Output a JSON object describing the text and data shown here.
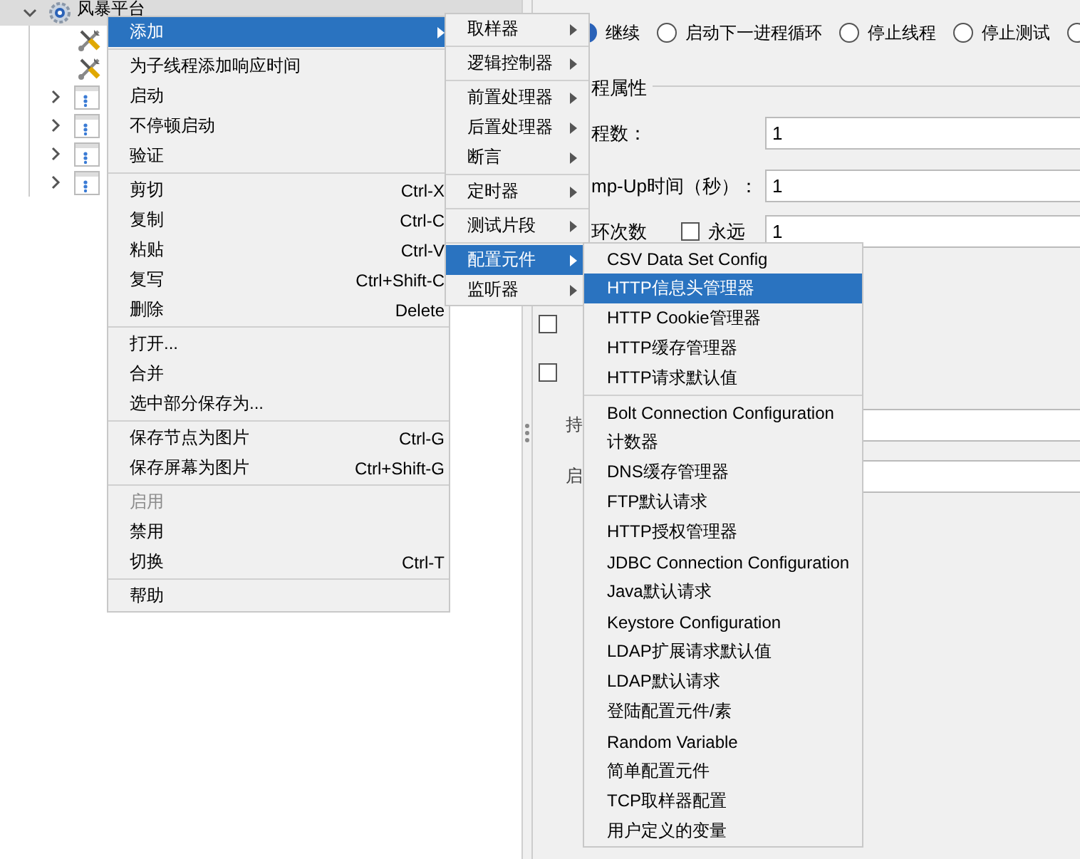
{
  "tree": {
    "root": {
      "label": "风暴平台",
      "expanded": true,
      "selected": true
    },
    "items": [
      {
        "kind": "tool"
      },
      {
        "kind": "tool"
      },
      {
        "kind": "group",
        "expanded": false
      },
      {
        "kind": "group",
        "expanded": false
      },
      {
        "kind": "group",
        "expanded": false
      },
      {
        "kind": "group",
        "expanded": false
      }
    ]
  },
  "panel": {
    "radios": [
      {
        "label": "继续",
        "selected": true
      },
      {
        "label": "启动下一进程循环",
        "selected": false
      },
      {
        "label": "停止线程",
        "selected": false
      },
      {
        "label": "停止测试",
        "selected": false
      },
      {
        "selected": false
      }
    ],
    "group_title": "程属性",
    "fields": [
      {
        "kind": "plain",
        "label": "程数：",
        "value": "1"
      },
      {
        "kind": "plain",
        "label": "mp-Up时间（秒）：",
        "value": "1"
      },
      {
        "kind": "loop",
        "label": "环次数",
        "check_label": "永远",
        "checked": false,
        "value": "1"
      }
    ],
    "checkboxes": [
      {
        "checked": false
      },
      {
        "checked": false
      }
    ],
    "rows": [
      {
        "label": "持"
      },
      {
        "label": "启"
      }
    ]
  },
  "context_menu": {
    "items": [
      {
        "kind": "item",
        "label": "添加",
        "submenu": true,
        "selected": true,
        "disabled": false
      },
      {
        "kind": "separator"
      },
      {
        "kind": "item",
        "label": "为子线程添加响应时间",
        "selected": false,
        "disabled": false
      },
      {
        "kind": "item",
        "label": "启动",
        "selected": false,
        "disabled": false
      },
      {
        "kind": "item",
        "label": "不停顿启动",
        "selected": false,
        "disabled": false
      },
      {
        "kind": "item",
        "label": "验证",
        "selected": false,
        "disabled": false
      },
      {
        "kind": "separator"
      },
      {
        "kind": "item",
        "label": "剪切",
        "shortcut": "Ctrl-X",
        "selected": false,
        "disabled": false
      },
      {
        "kind": "item",
        "label": "复制",
        "shortcut": "Ctrl-C",
        "selected": false,
        "disabled": false
      },
      {
        "kind": "item",
        "label": "粘贴",
        "shortcut": "Ctrl-V",
        "selected": false,
        "disabled": false
      },
      {
        "kind": "item",
        "label": "复写",
        "shortcut": "Ctrl+Shift-C",
        "selected": false,
        "disabled": false
      },
      {
        "kind": "item",
        "label": "删除",
        "shortcut": "Delete",
        "selected": false,
        "disabled": false
      },
      {
        "kind": "separator"
      },
      {
        "kind": "item",
        "label": "打开...",
        "selected": false,
        "disabled": false
      },
      {
        "kind": "item",
        "label": "合并",
        "selected": false,
        "disabled": false
      },
      {
        "kind": "item",
        "label": "选中部分保存为...",
        "selected": false,
        "disabled": false
      },
      {
        "kind": "separator"
      },
      {
        "kind": "item",
        "label": "保存节点为图片",
        "shortcut": "Ctrl-G",
        "selected": false,
        "disabled": false
      },
      {
        "kind": "item",
        "label": "保存屏幕为图片",
        "shortcut": "Ctrl+Shift-G",
        "selected": false,
        "disabled": false
      },
      {
        "kind": "separator"
      },
      {
        "kind": "item",
        "label": "启用",
        "selected": false,
        "disabled": true
      },
      {
        "kind": "item",
        "label": "禁用",
        "selected": false,
        "disabled": false
      },
      {
        "kind": "item",
        "label": "切换",
        "shortcut": "Ctrl-T",
        "selected": false,
        "disabled": false
      },
      {
        "kind": "separator"
      },
      {
        "kind": "item",
        "label": "帮助",
        "selected": false,
        "disabled": false
      }
    ]
  },
  "add_submenu": {
    "items": [
      {
        "kind": "item",
        "label": "取样器",
        "submenu": true,
        "selected": false
      },
      {
        "kind": "separator"
      },
      {
        "kind": "item",
        "label": "逻辑控制器",
        "submenu": true,
        "selected": false
      },
      {
        "kind": "separator"
      },
      {
        "kind": "item",
        "label": "前置处理器",
        "submenu": true,
        "selected": false
      },
      {
        "kind": "item",
        "label": "后置处理器",
        "submenu": true,
        "selected": false
      },
      {
        "kind": "item",
        "label": "断言",
        "submenu": true,
        "selected": false
      },
      {
        "kind": "separator"
      },
      {
        "kind": "item",
        "label": "定时器",
        "submenu": true,
        "selected": false
      },
      {
        "kind": "separator"
      },
      {
        "kind": "item",
        "label": "测试片段",
        "submenu": true,
        "selected": false
      },
      {
        "kind": "separator"
      },
      {
        "kind": "item",
        "label": "配置元件",
        "submenu": true,
        "selected": true
      },
      {
        "kind": "item",
        "label": "监听器",
        "submenu": true,
        "selected": false
      }
    ]
  },
  "config_submenu": {
    "items": [
      {
        "kind": "item",
        "label": "CSV Data Set Config",
        "selected": false
      },
      {
        "kind": "item",
        "label": "HTTP信息头管理器",
        "selected": true
      },
      {
        "kind": "item",
        "label": "HTTP Cookie管理器",
        "selected": false
      },
      {
        "kind": "item",
        "label": "HTTP缓存管理器",
        "selected": false
      },
      {
        "kind": "item",
        "label": "HTTP请求默认值",
        "selected": false
      },
      {
        "kind": "separator"
      },
      {
        "kind": "item",
        "label": "Bolt Connection Configuration",
        "selected": false
      },
      {
        "kind": "item",
        "label": "计数器",
        "selected": false
      },
      {
        "kind": "item",
        "label": "DNS缓存管理器",
        "selected": false
      },
      {
        "kind": "item",
        "label": "FTP默认请求",
        "selected": false
      },
      {
        "kind": "item",
        "label": "HTTP授权管理器",
        "selected": false
      },
      {
        "kind": "item",
        "label": "JDBC Connection Configuration",
        "selected": false
      },
      {
        "kind": "item",
        "label": "Java默认请求",
        "selected": false
      },
      {
        "kind": "item",
        "label": "Keystore Configuration",
        "selected": false
      },
      {
        "kind": "item",
        "label": "LDAP扩展请求默认值",
        "selected": false
      },
      {
        "kind": "item",
        "label": "LDAP默认请求",
        "selected": false
      },
      {
        "kind": "item",
        "label": "登陆配置元件/素",
        "selected": false
      },
      {
        "kind": "item",
        "label": "Random Variable",
        "selected": false
      },
      {
        "kind": "item",
        "label": "简单配置元件",
        "selected": false
      },
      {
        "kind": "item",
        "label": "TCP取样器配置",
        "selected": false
      },
      {
        "kind": "item",
        "label": "用户定义的变量",
        "selected": false
      }
    ]
  }
}
